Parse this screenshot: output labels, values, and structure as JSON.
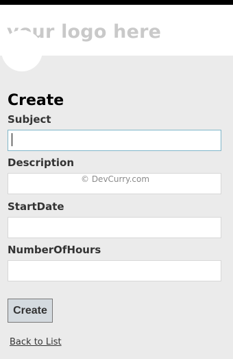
{
  "header": {
    "logo_text": "your logo here"
  },
  "form": {
    "title": "Create",
    "fields": [
      {
        "label": "Subject",
        "value": ""
      },
      {
        "label": "Description",
        "value": ""
      },
      {
        "label": "StartDate",
        "value": ""
      },
      {
        "label": "NumberOfHours",
        "value": ""
      }
    ],
    "submit_label": "Create",
    "back_link": "Back to List"
  },
  "watermark": "© DevCurry.com",
  "colors": {
    "topbar": "#000000",
    "background": "#ebebeb",
    "logo_text": "#c9c9c9",
    "focus_border": "#7fb6c9",
    "button_bg": "#d4dadf"
  }
}
